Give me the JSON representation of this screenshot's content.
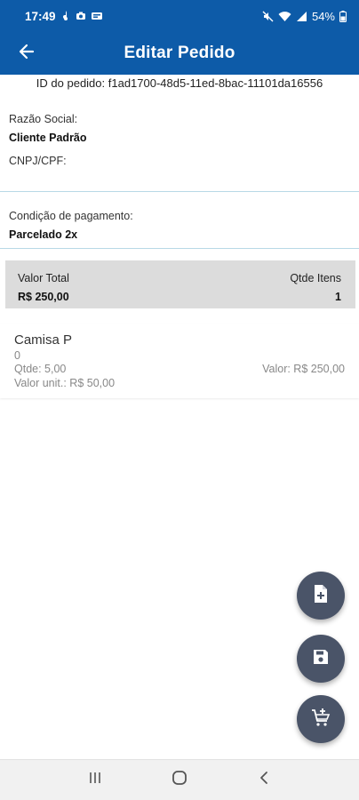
{
  "status_bar": {
    "time": "17:49",
    "battery_percent": "54%",
    "icons_left": [
      "notification-icon",
      "camera-icon",
      "media-icon"
    ],
    "icons_right": [
      "mute-icon",
      "wifi-icon",
      "signal-icon",
      "battery-icon"
    ]
  },
  "app_bar": {
    "title": "Editar Pedido",
    "back_icon": "arrow-left-icon"
  },
  "order": {
    "id_text": "ID do pedido: f1ad1700-48d5-11ed-8bac-11101da16556"
  },
  "client": {
    "company_label": "Razão Social:",
    "company_value": "Cliente Padrão",
    "document_label": "CNPJ/CPF:",
    "document_value": ""
  },
  "payment": {
    "label": "Condição de pagamento:",
    "value": "Parcelado 2x"
  },
  "summary": {
    "total_label": "Valor Total",
    "total_value": "R$ 250,00",
    "qty_label": "Qtde Itens",
    "qty_value": "1"
  },
  "items": [
    {
      "name": "Camisa P",
      "code": "0",
      "qty_text": "Qtde:  5,00",
      "unit_text": "Valor unit.: R$ 50,00",
      "value_text": "Valor: R$ 250,00"
    }
  ],
  "fabs": [
    {
      "icon": "add-document-icon"
    },
    {
      "icon": "save-icon"
    },
    {
      "icon": "add-cart-icon"
    }
  ],
  "colors": {
    "primary": "#0d5ba8",
    "fab": "#4a5468",
    "summary_bg": "#dcdcdc",
    "divider": "#b8d9e6"
  },
  "nav": [
    "recent-apps-icon",
    "home-icon",
    "back-nav-icon"
  ]
}
